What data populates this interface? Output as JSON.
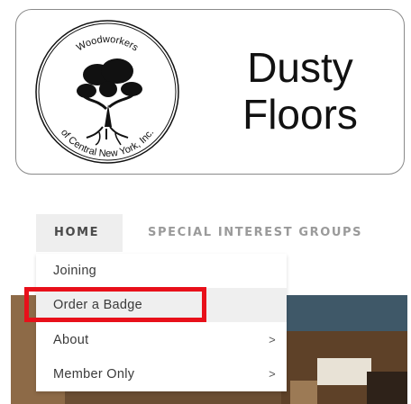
{
  "badge": {
    "seal_text_top": "Woodworkers",
    "seal_text_bottom": "of Central New York, Inc.",
    "name_line1": "Dusty",
    "name_line2": "Floors"
  },
  "nav": {
    "home_label": "HOME",
    "sig_label": "SPECIAL INTEREST GROUPS"
  },
  "dropdown": {
    "items": [
      {
        "label": "Joining",
        "arrow": ""
      },
      {
        "label": "Order a Badge",
        "arrow": ""
      },
      {
        "label": "About",
        "arrow": ">"
      },
      {
        "label": "Member Only",
        "arrow": ">"
      }
    ]
  },
  "colors": {
    "highlight": "#e8101a"
  }
}
